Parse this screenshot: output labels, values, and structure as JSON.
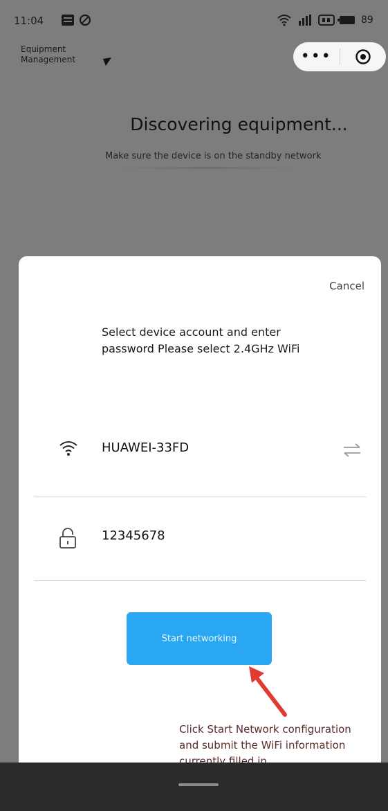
{
  "status_bar": {
    "time": "11:04",
    "battery": "89"
  },
  "header": {
    "title_line1": "Equipment",
    "title_line2": "Management",
    "more_label": "•••"
  },
  "discovery": {
    "title": "Discovering equipment...",
    "subtitle": "Make sure the device is on the standby network"
  },
  "sheet": {
    "cancel_label": "Cancel",
    "instruction": "Select device account and enter password Please select 2.4GHz WiFi",
    "wifi_name": "HUAWEI-33FD",
    "password": "12345678",
    "start_button_label": "Start networking",
    "annotation": "Click Start Network configuration and submit the WiFi information currently filled in"
  },
  "colors": {
    "primary_button": "#2aa7f3",
    "overlay": "#7d7d7d",
    "annotation_arrow": "#e03a32"
  }
}
